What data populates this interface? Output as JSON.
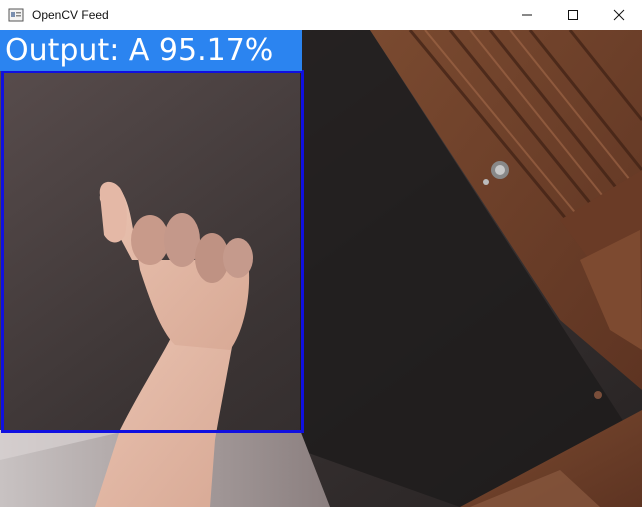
{
  "window": {
    "title": "OpenCV Feed",
    "icon": "window-app-icon",
    "controls": [
      "minimize-icon",
      "maximize-icon",
      "close-icon"
    ]
  },
  "feed": {
    "output_text": "Output: A 95.17%",
    "label_color": "#2b84f0",
    "box_color": "#1010e0"
  }
}
